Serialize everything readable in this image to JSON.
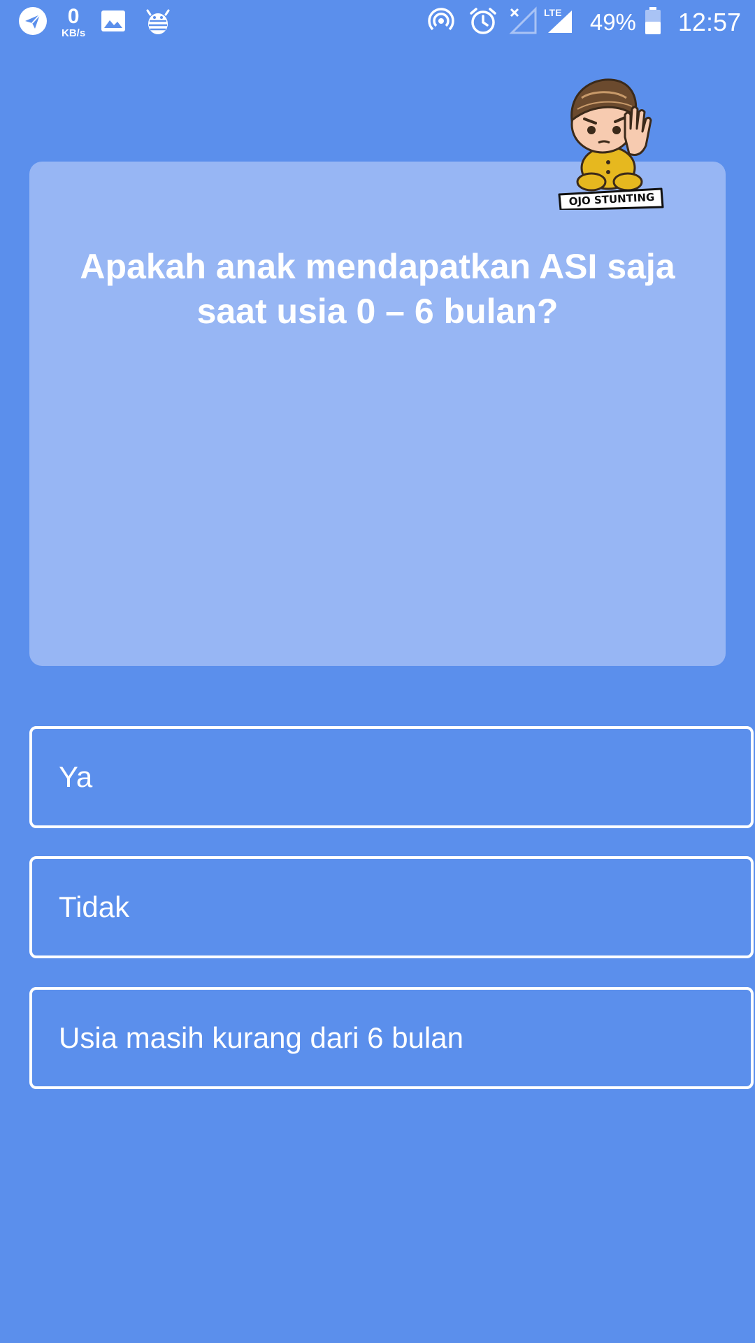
{
  "status_bar": {
    "network_speed_value": "0",
    "network_speed_unit": "KB/s",
    "network_type": "LTE",
    "battery_percent": "49%",
    "time": "12:57",
    "icons": [
      "telegram-icon",
      "image-icon",
      "debug-bug-icon",
      "hotspot-icon",
      "alarm-icon",
      "no-signal-icon",
      "lte-signal-icon",
      "battery-icon"
    ]
  },
  "mascot": {
    "label": "OJO STUNTING"
  },
  "question": {
    "text": "Apakah anak mendapatkan ASI saja saat usia 0 – 6 bulan?"
  },
  "answers": [
    {
      "label": "Ya"
    },
    {
      "label": "Tidak"
    },
    {
      "label": "Usia masih kurang dari 6 bulan"
    }
  ],
  "colors": {
    "background": "#5b8fec",
    "card": "#97b6f4",
    "text": "#ffffff"
  }
}
